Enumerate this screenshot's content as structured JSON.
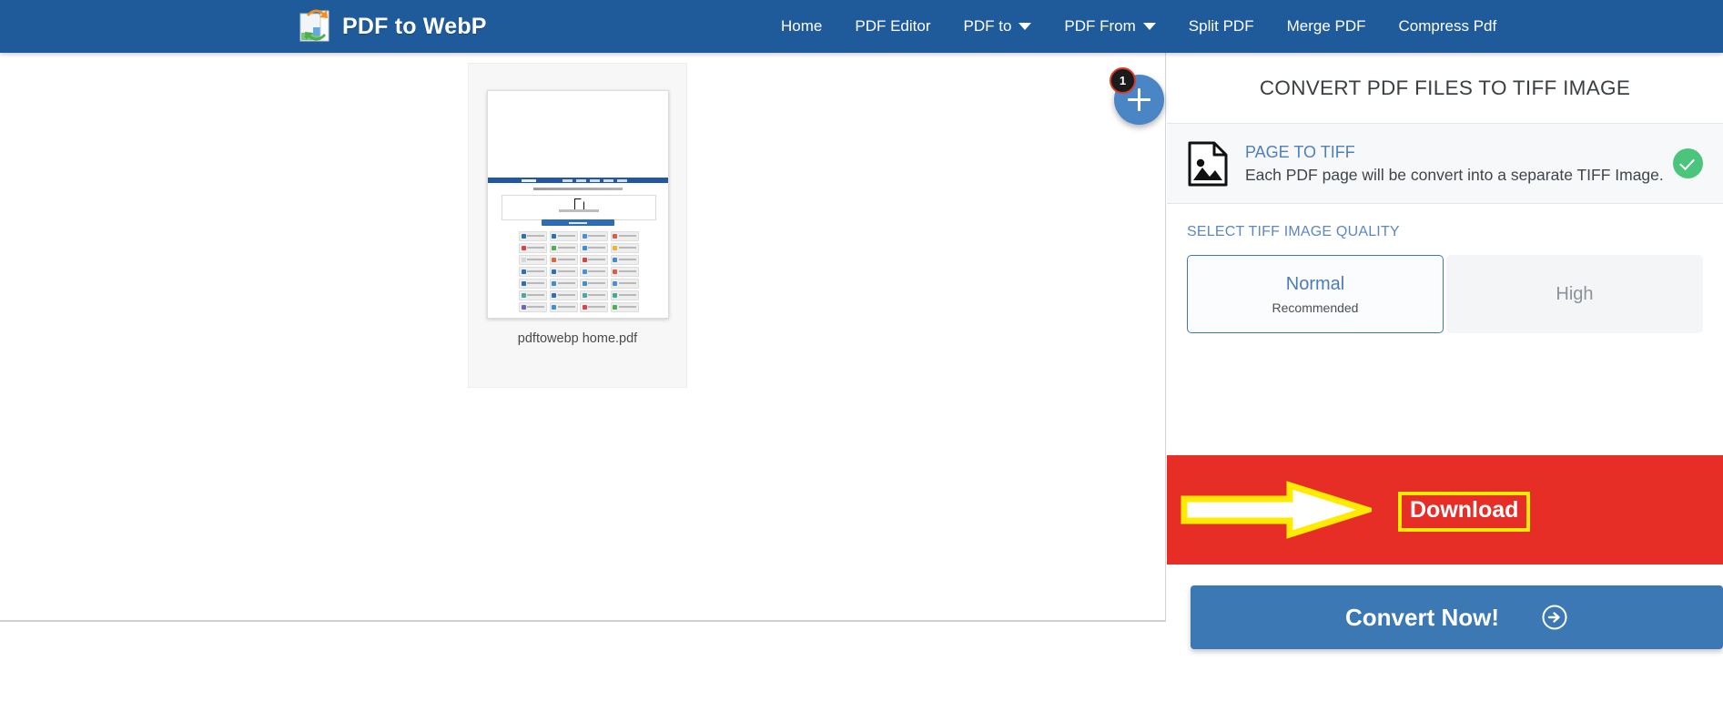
{
  "navbar": {
    "brand": "PDF to WebP",
    "brand_icon": "pdf-to-webp-logo-icon",
    "background": "#1f5b9b",
    "items": [
      {
        "label": "Home",
        "has_caret": false
      },
      {
        "label": "PDF Editor",
        "has_caret": false
      },
      {
        "label": "PDF to",
        "has_caret": true
      },
      {
        "label": "PDF From",
        "has_caret": true
      },
      {
        "label": "Split PDF",
        "has_caret": false
      },
      {
        "label": "Merge PDF",
        "has_caret": false
      },
      {
        "label": "Compress Pdf",
        "has_caret": false
      }
    ]
  },
  "workarea": {
    "thumbnail": {
      "filename": "pdftowebp home.pdf"
    },
    "add_file": {
      "icon": "plus-icon",
      "badge_count": "1"
    }
  },
  "panel": {
    "title": "CONVERT PDF FILES TO TIFF IMAGE",
    "mode": {
      "icon": "image-document-icon",
      "heading": "PAGE TO TIFF",
      "description": "Each PDF page will be convert into a separate TIFF Image.",
      "status_icon": "check-circle-icon",
      "status_color": "#4bc47c"
    },
    "quality": {
      "label": "SELECT TIFF IMAGE QUALITY",
      "options": [
        {
          "name": "Normal",
          "note": "Recommended",
          "selected": true
        },
        {
          "name": "High",
          "note": "",
          "selected": false
        }
      ]
    },
    "download_banner": {
      "label": "Download",
      "background": "#e62d26",
      "highlight_color": "#ffea00",
      "arrow_icon": "right-arrow-annotation-icon"
    },
    "convert_button": {
      "label": "Convert Now!",
      "icon": "arrow-circle-right-icon",
      "background": "#3b78b4"
    }
  }
}
